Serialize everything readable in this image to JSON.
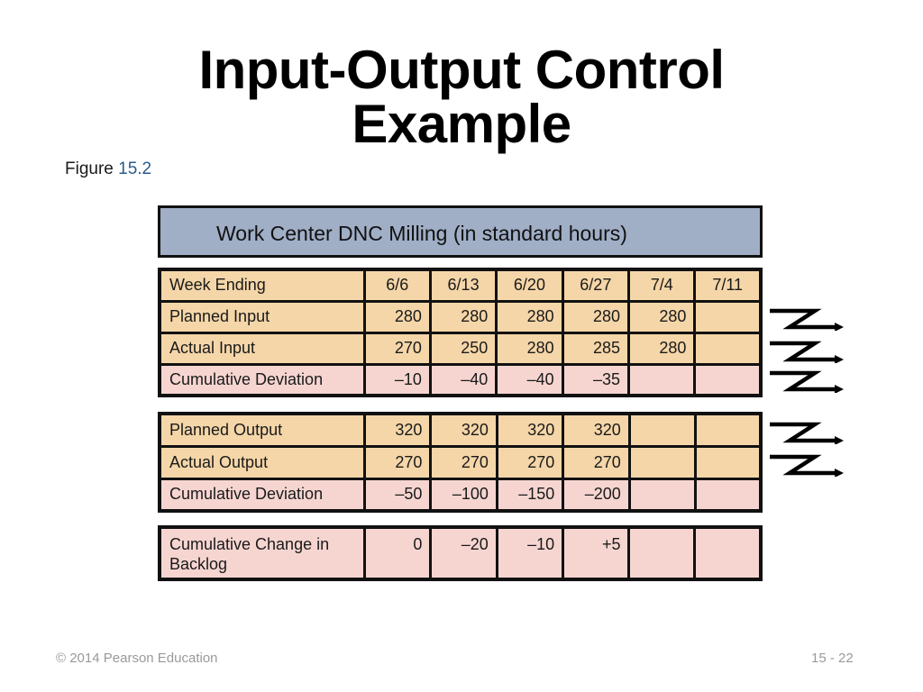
{
  "slide": {
    "title_line1": "Input-Output Control",
    "title_line2": "Example",
    "figure_prefix": "Figure",
    "figure_number": "15.2",
    "header": "Work Center DNC Milling (in standard hours)",
    "footer_left": "© 2014 Pearson Education",
    "footer_right": "15 - 22"
  },
  "colors": {
    "header_fill": "#a0aec6",
    "input_output_rows": "#f5d6a8",
    "deviation_rows": "#f6d5d1",
    "figure_number": "#2a5b8c"
  },
  "table_input": {
    "week_header": "Week Ending",
    "weeks": [
      "6/6",
      "6/13",
      "6/20",
      "6/27",
      "7/4",
      "7/11"
    ],
    "rows": [
      {
        "label": "Planned Input",
        "values": [
          "280",
          "280",
          "280",
          "280",
          "280",
          ""
        ]
      },
      {
        "label": "Actual Input",
        "values": [
          "270",
          "250",
          "280",
          "285",
          "280",
          ""
        ]
      },
      {
        "label": "Cumulative Deviation",
        "values": [
          "–10",
          "–40",
          "–40",
          "–35",
          "",
          ""
        ]
      }
    ]
  },
  "table_output": {
    "rows": [
      {
        "label": "Planned Output",
        "values": [
          "320",
          "320",
          "320",
          "320",
          "",
          ""
        ]
      },
      {
        "label": "Actual Output",
        "values": [
          "270",
          "270",
          "270",
          "270",
          "",
          ""
        ]
      },
      {
        "label": "Cumulative Deviation",
        "values": [
          "–50",
          "–100",
          "–150",
          "–200",
          "",
          ""
        ]
      }
    ]
  },
  "table_backlog": {
    "rows": [
      {
        "label": "Cumulative Change in Backlog",
        "values": [
          "0",
          "–20",
          "–10",
          "+5",
          "",
          ""
        ]
      }
    ]
  },
  "arrows": [
    "planned-input-arrow",
    "actual-input-arrow",
    "cumulative-input-deviation-arrow",
    "planned-output-arrow",
    "actual-output-arrow"
  ]
}
